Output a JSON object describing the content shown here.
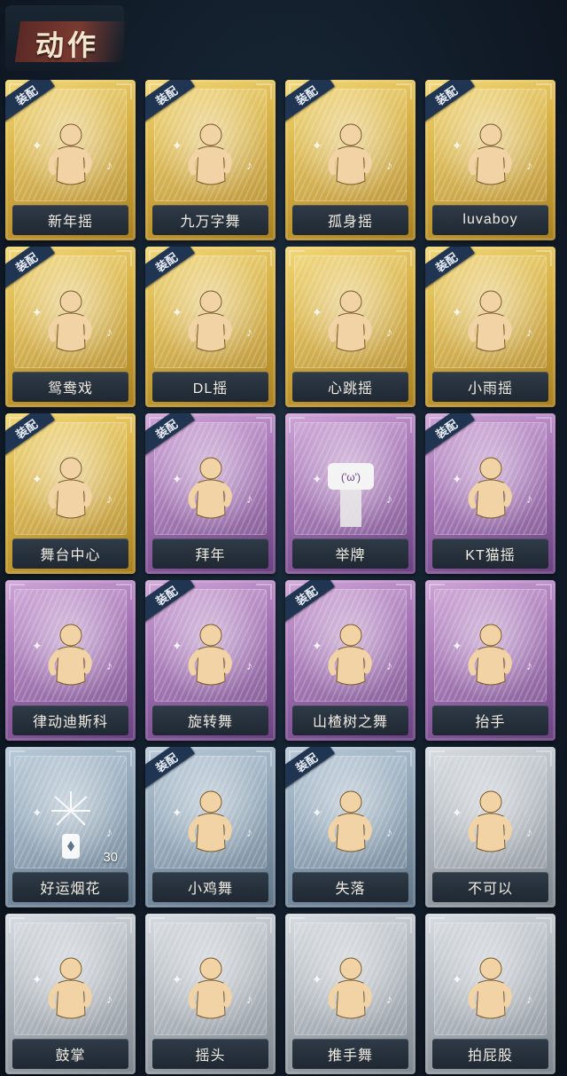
{
  "header": {
    "title": "动作"
  },
  "badge_label": "装配",
  "colors": {
    "gold": "#d9b448",
    "purple": "#a170b2",
    "blue": "#8ea4b6",
    "gray": "#aeb5bc",
    "badge": "#1f3552"
  },
  "cards": [
    {
      "label": "新年摇",
      "tier": "gold",
      "equipped": true,
      "icon": "dance-pose-icon"
    },
    {
      "label": "九万字舞",
      "tier": "gold",
      "equipped": true,
      "icon": "dance-pose-icon"
    },
    {
      "label": "孤身摇",
      "tier": "gold",
      "equipped": true,
      "icon": "dance-pose-icon"
    },
    {
      "label": "luvaboy",
      "tier": "gold",
      "equipped": true,
      "icon": "dance-pose-icon"
    },
    {
      "label": "鸳鸯戏",
      "tier": "gold",
      "equipped": true,
      "icon": "dance-pose-icon"
    },
    {
      "label": "DL摇",
      "tier": "gold",
      "equipped": true,
      "icon": "dance-pose-icon"
    },
    {
      "label": "心跳摇",
      "tier": "gold",
      "equipped": false,
      "icon": "dance-pose-icon"
    },
    {
      "label": "小雨摇",
      "tier": "gold",
      "equipped": true,
      "icon": "dance-pose-icon"
    },
    {
      "label": "舞台中心",
      "tier": "gold",
      "equipped": true,
      "icon": "dance-pose-icon"
    },
    {
      "label": "拜年",
      "tier": "purple",
      "equipped": true,
      "icon": "bow-pose-icon"
    },
    {
      "label": "举牌",
      "tier": "purple",
      "equipped": false,
      "icon": "sign-hold-icon"
    },
    {
      "label": "KT猫摇",
      "tier": "purple",
      "equipped": true,
      "icon": "dance-pose-icon"
    },
    {
      "label": "律动迪斯科",
      "tier": "purple",
      "equipped": false,
      "icon": "disco-pose-icon"
    },
    {
      "label": "旋转舞",
      "tier": "purple",
      "equipped": true,
      "icon": "spin-pose-icon"
    },
    {
      "label": "山楂树之舞",
      "tier": "purple",
      "equipped": true,
      "icon": "dance-pose-icon"
    },
    {
      "label": "抬手",
      "tier": "purple",
      "equipped": false,
      "icon": "raise-hand-icon"
    },
    {
      "label": "好运烟花",
      "tier": "blue",
      "equipped": false,
      "icon": "firework-icon",
      "count": "30"
    },
    {
      "label": "小鸡舞",
      "tier": "blue",
      "equipped": true,
      "icon": "chicken-dance-icon"
    },
    {
      "label": "失落",
      "tier": "blue",
      "equipped": true,
      "icon": "crawl-pose-icon"
    },
    {
      "label": "不可以",
      "tier": "gray",
      "equipped": false,
      "icon": "finger-wag-icon"
    },
    {
      "label": "鼓掌",
      "tier": "gray",
      "equipped": false,
      "icon": "clap-icon"
    },
    {
      "label": "摇头",
      "tier": "gray",
      "equipped": false,
      "icon": "head-shake-icon"
    },
    {
      "label": "推手舞",
      "tier": "gray",
      "equipped": false,
      "icon": "push-hand-icon"
    },
    {
      "label": "拍屁股",
      "tier": "gray",
      "equipped": false,
      "icon": "butt-slap-icon"
    }
  ]
}
